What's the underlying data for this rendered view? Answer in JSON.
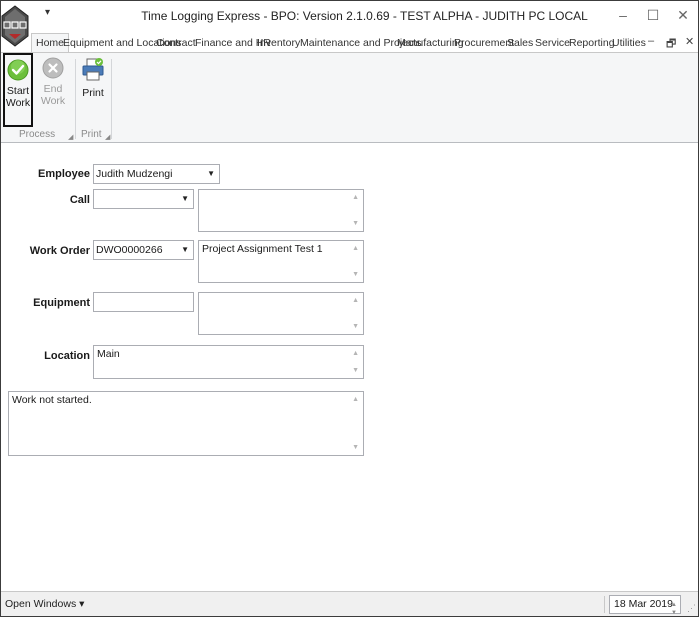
{
  "window": {
    "title": "Time Logging Express - BPO: Version 2.1.0.69 - TEST ALPHA - JUDITH PC LOCAL",
    "qat_symbol": "▾",
    "minimize": "–",
    "maximize": "☐",
    "close": "✕"
  },
  "tabs": [
    {
      "label": "Home"
    },
    {
      "label": "Equipment and Locations"
    },
    {
      "label": "Contract"
    },
    {
      "label": "Finance and HR"
    },
    {
      "label": "Inventory"
    },
    {
      "label": "Maintenance and Projects"
    },
    {
      "label": "Manufacturing"
    },
    {
      "label": "Procurement"
    },
    {
      "label": "Sales"
    },
    {
      "label": "Service"
    },
    {
      "label": "Reporting"
    },
    {
      "label": "Utilities"
    }
  ],
  "tab_controls": {
    "minimize": "–",
    "restore": "🗗",
    "close": "✕"
  },
  "ribbon": {
    "start_work": {
      "line1": "Start",
      "line2": "Work",
      "icon": "check-circle-icon"
    },
    "end_work": {
      "label": "End Work",
      "icon": "x-circle-icon"
    },
    "print": {
      "label": "Print",
      "icon": "printer-icon"
    },
    "groups": {
      "process": "Process",
      "print": "Print"
    }
  },
  "form": {
    "employee": {
      "label": "Employee",
      "value": "Judith Mudzengi"
    },
    "call": {
      "label": "Call",
      "value": "",
      "description": ""
    },
    "work_order": {
      "label": "Work Order",
      "value": "DWO0000266",
      "description": "Project Assignment Test 1"
    },
    "equipment": {
      "label": "Equipment",
      "value": "",
      "description": ""
    },
    "location": {
      "label": "Location",
      "value": "Main"
    },
    "status_memo": "Work not started."
  },
  "statusbar": {
    "open_windows": "Open Windows ▾",
    "date": "18 Mar 2019"
  },
  "colors": {
    "accent_green": "#6cbf3c",
    "disabled_gray": "#9a9a9a",
    "ribbon_bg": "#f5f6f7"
  }
}
